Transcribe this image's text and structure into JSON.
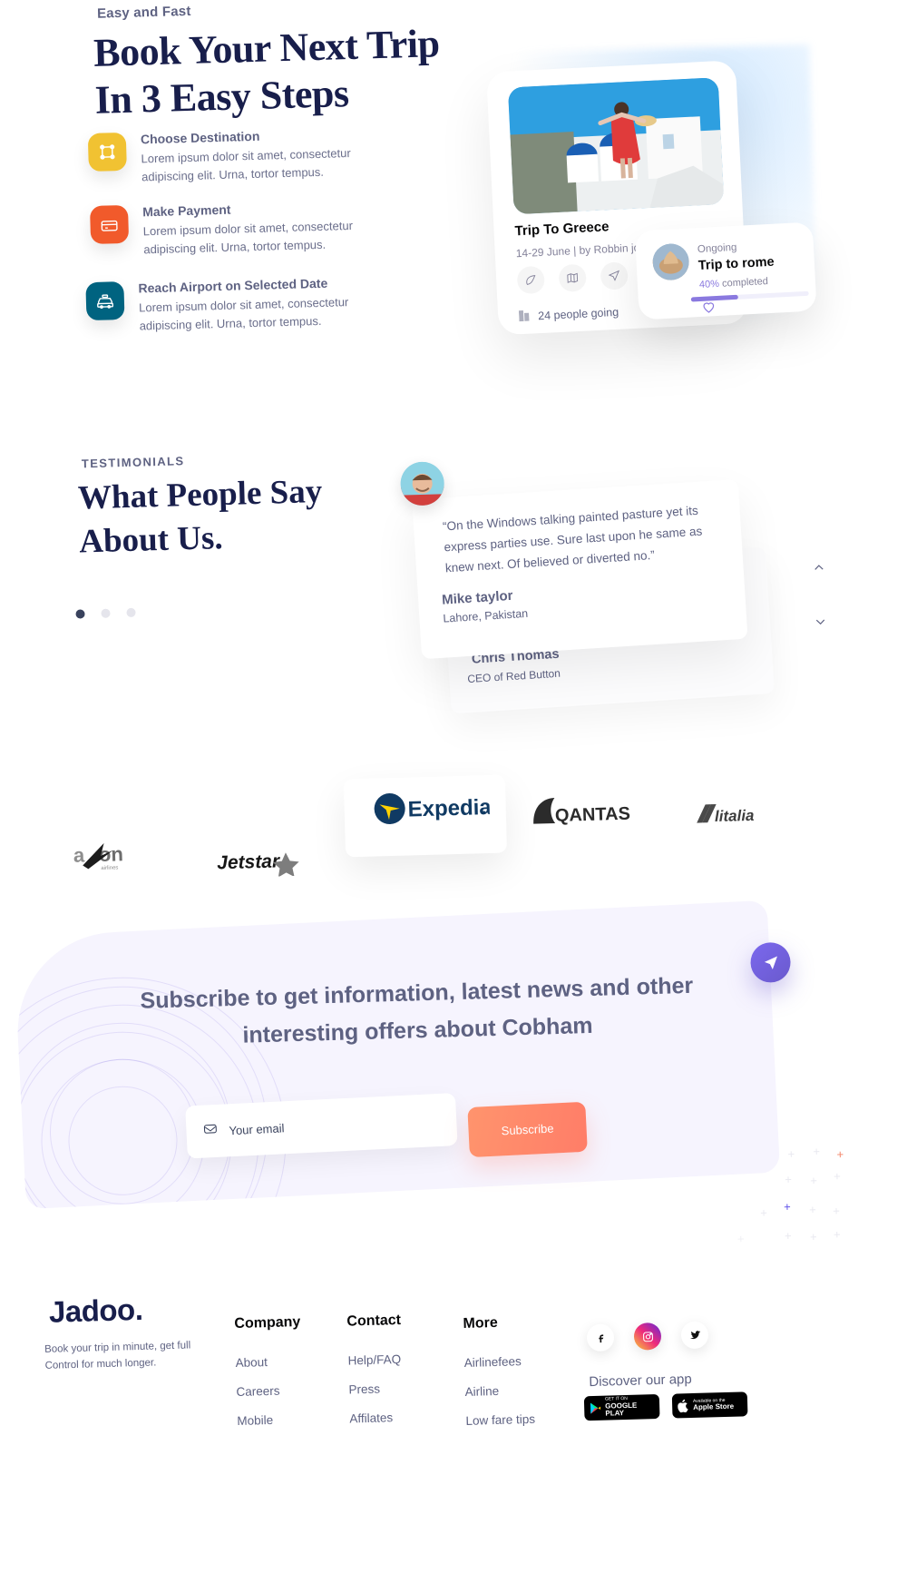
{
  "steps": {
    "eyebrow": "Easy and Fast",
    "heading": "Book Your Next Trip In 3 Easy Steps",
    "items": [
      {
        "icon": "crop-frame-icon",
        "color": "#F1C232",
        "title": "Choose Destination",
        "desc": "Lorem ipsum dolor sit amet, consectetur adipiscing elit. Urna, tortor tempus."
      },
      {
        "icon": "payment-icon",
        "color": "#F15A2B",
        "title": "Make Payment",
        "desc": "Lorem ipsum dolor sit amet, consectetur adipiscing elit. Urna, tortor tempus."
      },
      {
        "icon": "taxi-icon",
        "color": "#006380",
        "title": "Reach Airport on Selected Date",
        "desc": "Lorem ipsum dolor sit amet, consectetur adipiscing elit. Urna, tortor tempus."
      }
    ]
  },
  "trip_card": {
    "title": "Trip To Greece",
    "meta": "14-29 June | by Robbin jo",
    "actions": [
      "leaf-icon",
      "map-icon",
      "send-icon"
    ],
    "people_going": "24 people going",
    "building_icon": "building-icon"
  },
  "ongoing_card": {
    "label": "Ongoing",
    "title": "Trip to rome",
    "percent_text": "40%",
    "completed_text": "completed",
    "progress": 40,
    "progress_color": "#8A79DF",
    "heart_icon": "heart-icon"
  },
  "testimonials": {
    "eyebrow": "TESTIMONIALS",
    "heading": "What People Say About Us.",
    "dots": 3,
    "active_dot": 0,
    "front": {
      "quote": "“On the Windows talking painted pasture yet its express parties use. Sure last upon he same as knew next. Of believed or diverted no.”",
      "name": "Mike taylor",
      "location": "Lahore, Pakistan"
    },
    "back": {
      "name": "Chris Thomas",
      "role": "CEO of Red Button"
    },
    "nav": {
      "up": "chevron-up-icon",
      "down": "chevron-down-icon"
    }
  },
  "logos": [
    {
      "name": "axon-airlines-logo",
      "text": "axon",
      "sub": "airlines"
    },
    {
      "name": "jetstar-logo",
      "text": "Jetstar"
    },
    {
      "name": "expedia-logo",
      "text": "Expedia"
    },
    {
      "name": "qantas-logo",
      "text": "QANTAS"
    },
    {
      "name": "alitalia-logo",
      "text": "Alitalia"
    }
  ],
  "subscribe": {
    "heading": "Subscribe to get information, latest news and other interesting offers about Cobham",
    "email_placeholder": "Your email",
    "email_value": "",
    "button_label": "Subscribe",
    "email_icon": "envelope-icon",
    "send_icon": "send-icon",
    "button_color": "#FF7D68"
  },
  "footer": {
    "brand": "Jadoo.",
    "tagline": "Book your trip in minute, get full Control for much longer.",
    "columns": [
      {
        "heading": "Company",
        "links": [
          "About",
          "Careers",
          "Mobile"
        ]
      },
      {
        "heading": "Contact",
        "links": [
          "Help/FAQ",
          "Press",
          "Affilates"
        ]
      },
      {
        "heading": "More",
        "links": [
          "Airlinefees",
          "Airline",
          "Low fare tips"
        ]
      }
    ],
    "socials": [
      "facebook-icon",
      "instagram-icon",
      "twitter-icon"
    ],
    "discover_label": "Discover our app",
    "stores": [
      {
        "name": "google-play-badge",
        "small": "GET IT ON",
        "big": "GOOGLE PLAY"
      },
      {
        "name": "apple-store-badge",
        "small": "Available on the",
        "big": "Apple Store"
      }
    ]
  }
}
